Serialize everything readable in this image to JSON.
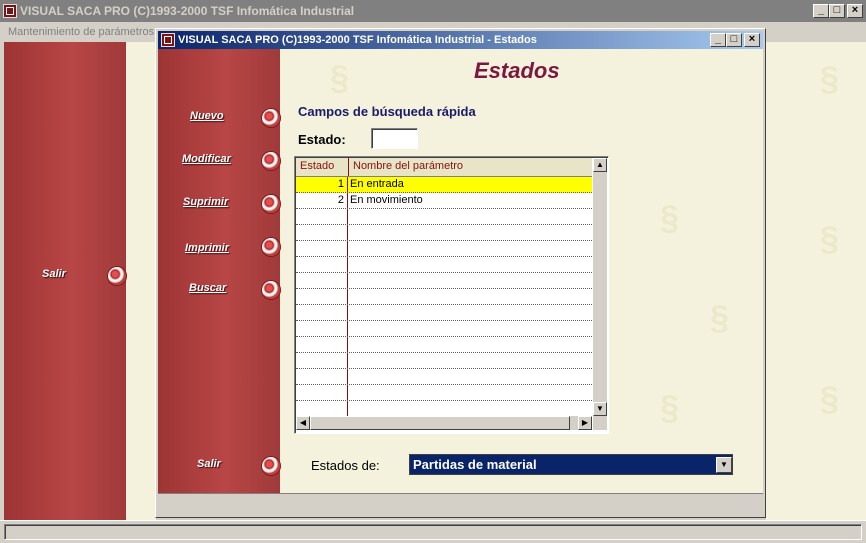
{
  "main_window": {
    "title": "VISUAL SACA PRO (C)1993-2000 TSF Infomática Industrial",
    "menu_item": "Mantenimiento de parámetros",
    "exit_label": "Salir"
  },
  "child_window": {
    "title": "VISUAL SACA PRO (C)1993-2000 TSF Infomática Industrial - Estados",
    "heading": "Estados",
    "nav": {
      "new": "Nuevo",
      "modify": "Modificar",
      "delete": "Suprimir",
      "print": "Imprimir",
      "search": "Buscar",
      "exit": "Salir"
    },
    "quick_search_title": "Campos de búsqueda rápida",
    "estado_label": "Estado:",
    "estado_value": "",
    "table": {
      "columns": [
        "Estado",
        "Nombre del parámetro"
      ],
      "rows": [
        {
          "estado": "1",
          "nombre": "En entrada",
          "selected": true
        },
        {
          "estado": "2",
          "nombre": "En movimiento",
          "selected": false
        }
      ]
    },
    "estados_de_label": "Estados de:",
    "estados_de_value": "Partidas de material"
  },
  "window_buttons": {
    "minimize": "_",
    "maximize": "□",
    "close": "×"
  },
  "icons": {
    "app": "app-icon",
    "combo_arrow": "chevron-down-icon"
  },
  "colors": {
    "title_active": "#0a246a",
    "nav_panel": "#b84646",
    "selected_row": "#ffff00",
    "heading": "#7a1840"
  }
}
